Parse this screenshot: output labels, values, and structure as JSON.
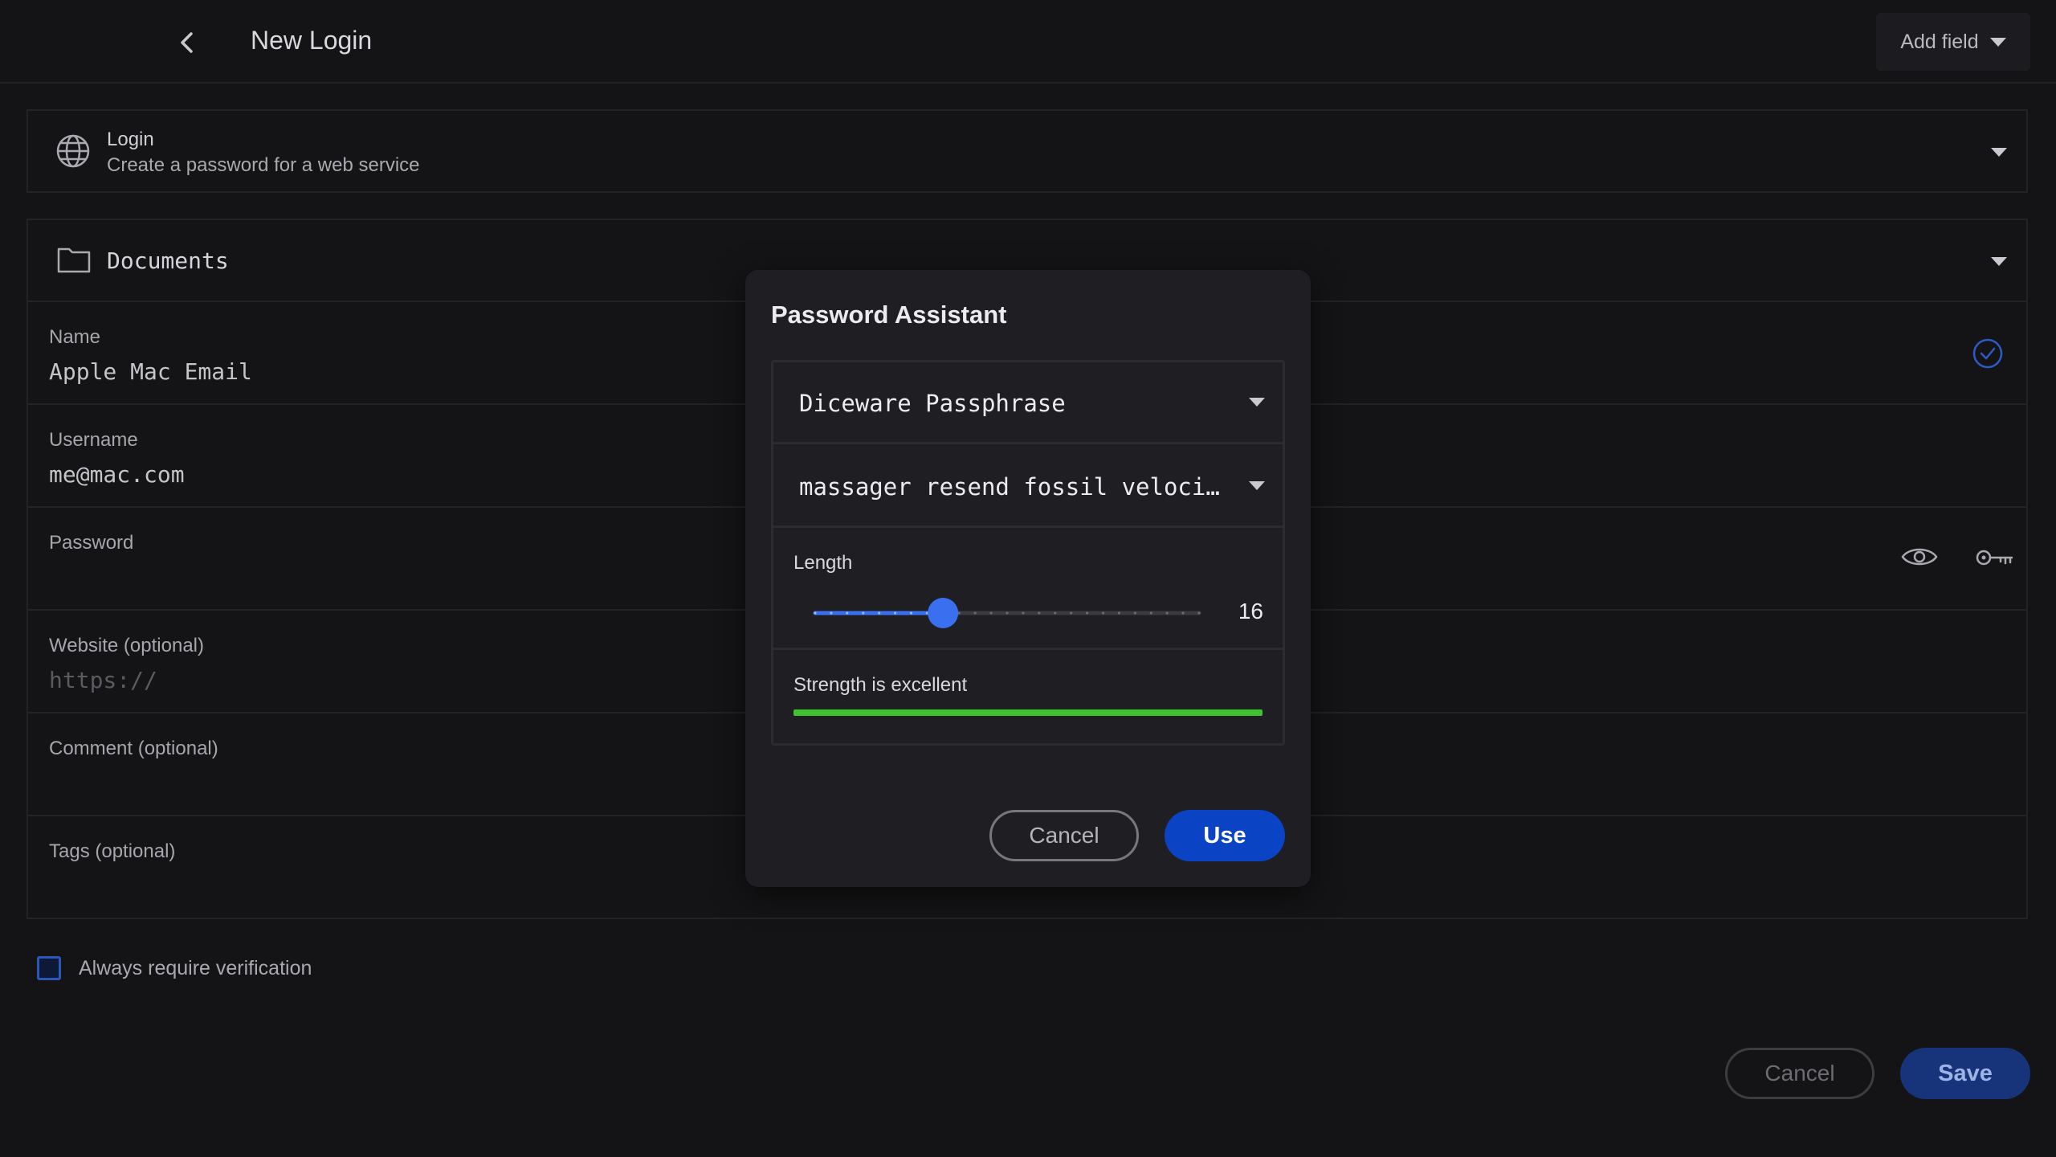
{
  "header": {
    "title": "New Login",
    "add_field_label": "Add field"
  },
  "type_selector": {
    "title": "Login",
    "subtitle": "Create a password for a web service"
  },
  "vault": {
    "label": "Documents"
  },
  "fields": {
    "name": {
      "label": "Name",
      "value": "Apple Mac Email"
    },
    "username": {
      "label": "Username",
      "value": "me@mac.com"
    },
    "password": {
      "label": "Password",
      "value": ""
    },
    "website": {
      "label": "Website (optional)",
      "placeholder": "https://"
    },
    "comment": {
      "label": "Comment (optional)"
    },
    "tags": {
      "label": "Tags (optional)"
    }
  },
  "verification": {
    "label": "Always require verification",
    "checked": false
  },
  "footer": {
    "cancel_label": "Cancel",
    "save_label": "Save"
  },
  "modal": {
    "title": "Password Assistant",
    "generator_type": "Diceware Passphrase",
    "generated_password": "massager resend fossil velocity",
    "length_label": "Length",
    "length_value": "16",
    "length_fraction": 0.333,
    "strength_label": "Strength is excellent",
    "strength_fraction": 1.0,
    "cancel_label": "Cancel",
    "use_label": "Use"
  },
  "colors": {
    "accent": "#0a43c3",
    "strength": "#3fc130",
    "slider": "#3a6ff0"
  },
  "icons": [
    "chevron-left-icon",
    "chevron-down-icon",
    "globe-icon",
    "folder-icon",
    "check-circle-icon",
    "eye-icon",
    "key-icon"
  ]
}
